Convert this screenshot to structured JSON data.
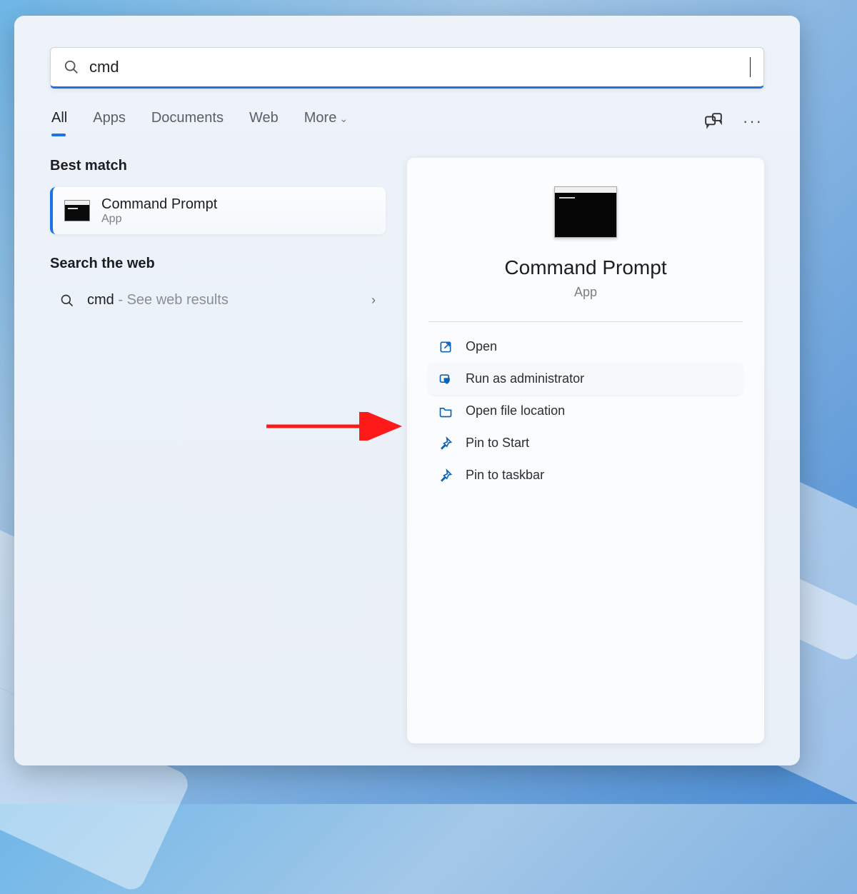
{
  "search": {
    "value": "cmd"
  },
  "tabs": {
    "all": "All",
    "apps": "Apps",
    "documents": "Documents",
    "web": "Web",
    "more": "More"
  },
  "left": {
    "bestMatchLabel": "Best match",
    "result": {
      "title": "Command Prompt",
      "subtitle": "App"
    },
    "searchWebLabel": "Search the web",
    "webResult": {
      "query": "cmd",
      "hint": " - See web results"
    }
  },
  "detail": {
    "title": "Command Prompt",
    "subtitle": "App",
    "actions": {
      "open": "Open",
      "runAdmin": "Run as administrator",
      "openLocation": "Open file location",
      "pinStart": "Pin to Start",
      "pinTaskbar": "Pin to taskbar"
    }
  }
}
